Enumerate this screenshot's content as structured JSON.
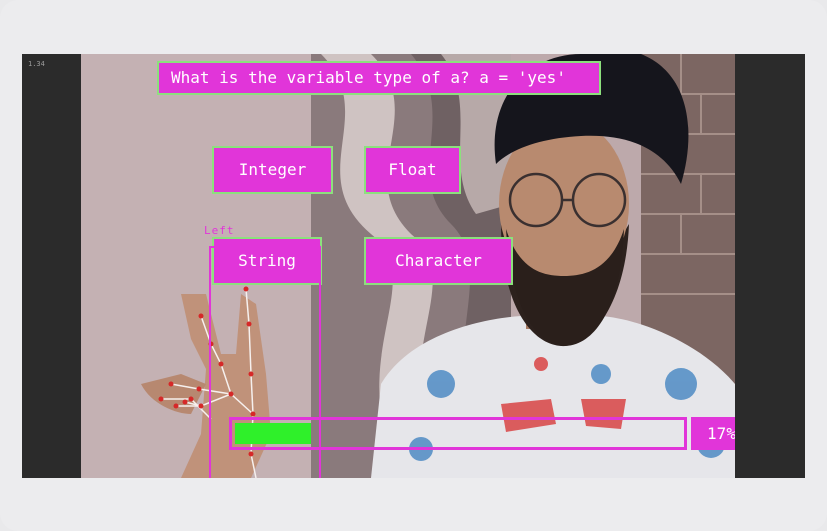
{
  "fps_text": "1.34",
  "question": {
    "text": "What is the variable type of a? a = 'yes'"
  },
  "options": [
    {
      "label": "Integer"
    },
    {
      "label": "Float"
    },
    {
      "label": "String"
    },
    {
      "label": "Character"
    }
  ],
  "hand_detection": {
    "label": "Left"
  },
  "progress": {
    "percent": 17,
    "label": "17%"
  },
  "colors": {
    "accent_magenta": "#e135d9",
    "border_green": "#8ce07d",
    "progress_green": "#2ff02a",
    "landmark_red": "#d62828"
  }
}
